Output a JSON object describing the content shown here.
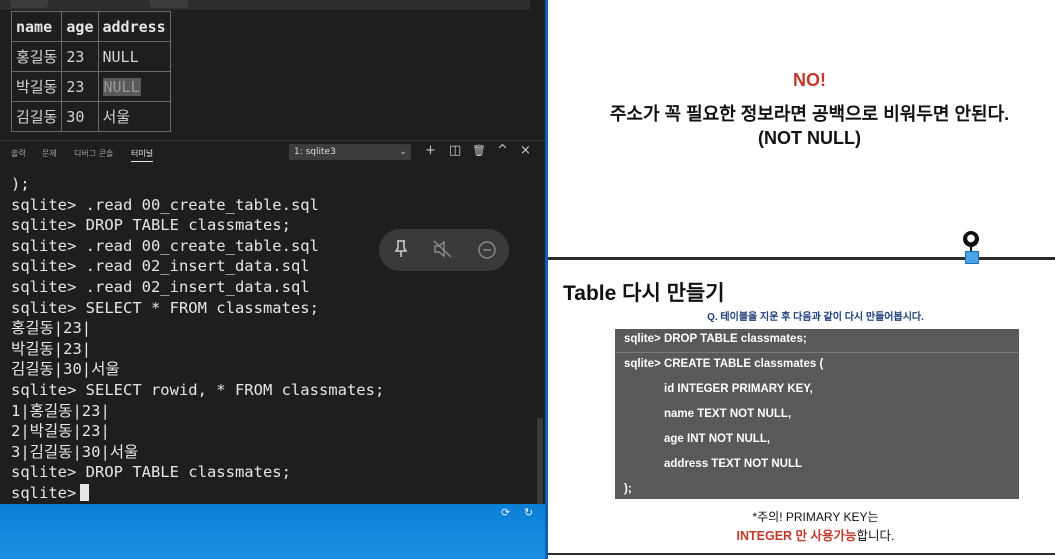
{
  "result_table": {
    "headers": [
      "name",
      "age",
      "address"
    ],
    "rows": [
      [
        "홍길동",
        "23",
        "NULL"
      ],
      [
        "박길동",
        "23",
        "NULL"
      ],
      [
        "김길동",
        "30",
        "서울"
      ]
    ]
  },
  "panel": {
    "tabs": [
      "출력",
      "문제",
      "디버그 콘솔",
      "터미널"
    ],
    "terminal_select": "1: sqlite3",
    "icons": {
      "add": "+",
      "split": "◫",
      "trash": "🗑",
      "maximize": "^",
      "close": "×"
    }
  },
  "terminal": {
    "lines": [
      ");",
      "sqlite> .read 00_create_table.sql",
      "sqlite> DROP TABLE classmates;",
      "sqlite> .read 00_create_table.sql",
      "sqlite> .read 02_insert_data.sql",
      "sqlite> .read 02_insert_data.sql",
      "sqlite> SELECT * FROM classmates;",
      "홍길동|23|",
      "박길동|23|",
      "김길동|30|서울",
      "sqlite> SELECT rowid, * FROM classmates;",
      "1|홍길동|23|",
      "2|박길동|23|",
      "3|김길동|30|서울",
      "sqlite> DROP TABLE classmates;"
    ],
    "prompt": "sqlite>"
  },
  "slide1": {
    "no": "NO!",
    "line1": "주소가 꼭 필요한 정보라면 공백으로 비워두면 안된다.",
    "line2": "(NOT NULL)"
  },
  "slide2": {
    "title": "Table 다시 만들기",
    "question": "Q. 테이블을 지운 후 다음과 같이 다시 만들어봅시다.",
    "code": [
      "sqlite> DROP TABLE classmates;",
      "sqlite> CREATE TABLE classmates (",
      "id INTEGER PRIMARY KEY,",
      "name TEXT NOT NULL,",
      "age    INT NOT NULL,",
      "address TEXT NOT NULL",
      ");"
    ],
    "note_line1": "*주의! PRIMARY KEY는",
    "note_red": "INTEGER 만 사용가능",
    "note_tail": "합니다."
  }
}
